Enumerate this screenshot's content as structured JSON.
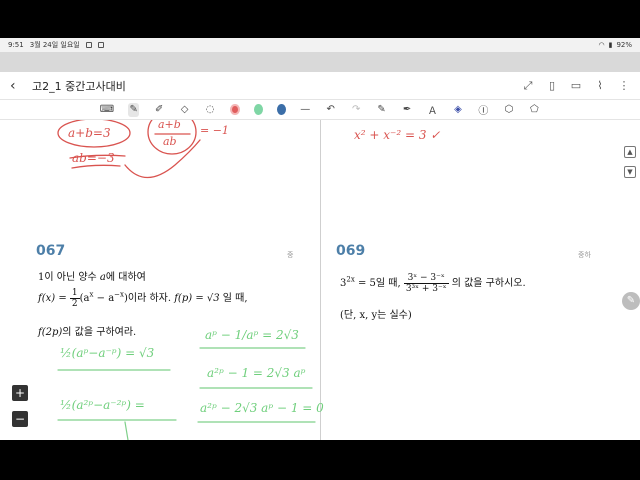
{
  "status": {
    "time": "9:51",
    "date": "3월 24일 일요일",
    "battery": "92%"
  },
  "header": {
    "title": "고2_1 중간고사대비"
  },
  "toolbar": {
    "colors": [
      "#e05d5d",
      "#7fd6a5",
      "#3b6ea8"
    ]
  },
  "problems": {
    "left": {
      "number": "067",
      "difficulty": "중",
      "line1_pre": "1이 아닌 양수 ",
      "line1_var": "a",
      "line1_post": "에 대하여",
      "line2_func": "f(x) =",
      "line2_frac_num": "1",
      "line2_frac_den": "2",
      "line2_expr": "(a",
      "line2_exp1": "x",
      "line2_minus": " − a",
      "line2_exp2": "−x",
      "line2_close": ")",
      "line2_text": "이라 하자. ",
      "line2_fp": "f(p) = √3",
      "line2_when": " 일 때,",
      "line3_f2p": "f(2p)",
      "line3_text": "의 값을 구하여라."
    },
    "right": {
      "number": "069",
      "difficulty": "중하",
      "line1_base": "3",
      "line1_exp": "2x",
      "line1_eq": " = 5일 때, ",
      "frac_num": "3ˣ − 3⁻ˣ",
      "frac_den": "3³ˣ + 3⁻ˣ",
      "line1_post": " 의 값을 구하시오.",
      "line2": "(단, x, y는 실수)"
    }
  },
  "handwriting": {
    "red_top_left_1": "a+b=3",
    "red_top_left_2": "ab=−3",
    "red_top_mid_num": "a+b",
    "red_top_mid_den": "ab",
    "red_top_mid_eq": "= −1",
    "red_top_right": "x² + x⁻² = 3 ✓",
    "green_left_1": "½(aᵖ−a⁻ᵖ) = √3",
    "green_left_2": "½(a²ᵖ−a⁻²ᵖ) =",
    "green_right_1": "aᵖ − 1/aᵖ = 2√3",
    "green_right_2": "a²ᵖ − 1 = 2√3 aᵖ",
    "green_right_3": "a²ᵖ − 2√3 aᵖ − 1 = 0"
  },
  "controls": {
    "zoom_in": "+",
    "zoom_out": "−"
  }
}
